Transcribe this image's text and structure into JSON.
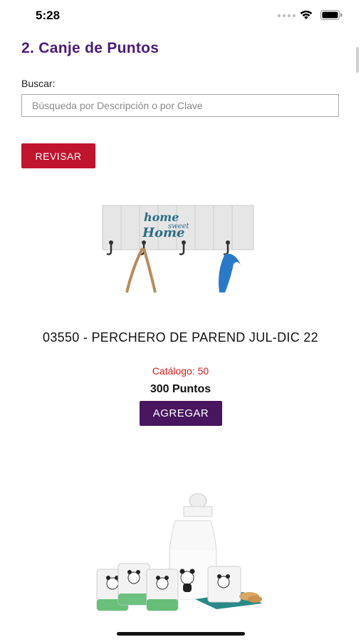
{
  "status_bar": {
    "time": "5:28"
  },
  "page": {
    "title": "2. Canje de Puntos"
  },
  "search": {
    "label": "Buscar:",
    "placeholder": "Búsqueda por Descripción o por Clave",
    "value": ""
  },
  "review_button": {
    "label": "REVISAR"
  },
  "products": [
    {
      "title": "03550 - PERCHERO DE PAREND JUL-DIC 22",
      "catalog": "Catálogo: 50",
      "points": "300 Puntos",
      "add_label": "AGREGAR",
      "image_text_1": "home",
      "image_text_2": "sweet",
      "image_text_3": "Home"
    },
    {
      "image": "panda-glass-set"
    }
  ],
  "colors": {
    "title": "#4a1a7a",
    "review_button": "#c0142f",
    "add_button": "#47165f",
    "catalog_text": "#e01d1d"
  }
}
